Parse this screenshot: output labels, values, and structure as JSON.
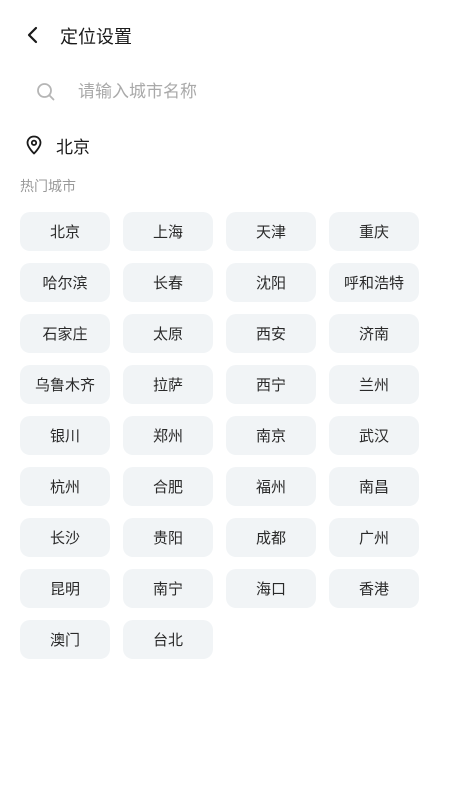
{
  "header": {
    "title": "定位设置"
  },
  "search": {
    "placeholder": "请输入城市名称"
  },
  "current_location": {
    "city": "北京"
  },
  "hot_cities": {
    "label": "热门城市",
    "items": [
      "北京",
      "上海",
      "天津",
      "重庆",
      "哈尔滨",
      "长春",
      "沈阳",
      "呼和浩特",
      "石家庄",
      "太原",
      "西安",
      "济南",
      "乌鲁木齐",
      "拉萨",
      "西宁",
      "兰州",
      "银川",
      "郑州",
      "南京",
      "武汉",
      "杭州",
      "合肥",
      "福州",
      "南昌",
      "长沙",
      "贵阳",
      "成都",
      "广州",
      "昆明",
      "南宁",
      "海口",
      "香港",
      "澳门",
      "台北"
    ]
  },
  "colors": {
    "chip_background": "#f1f4f6",
    "text_primary": "#1a1a1a",
    "text_secondary": "#9a9a9a"
  }
}
